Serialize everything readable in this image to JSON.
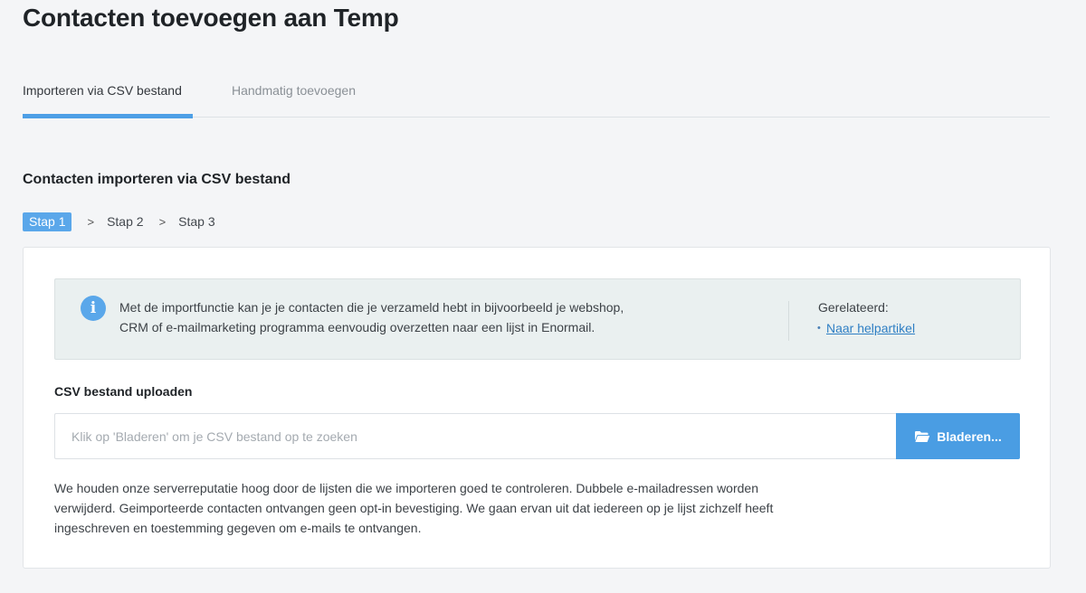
{
  "page": {
    "title": "Contacten toevoegen aan Temp"
  },
  "tabs": [
    {
      "label": "Importeren via CSV bestand",
      "active": true
    },
    {
      "label": "Handmatig toevoegen",
      "active": false
    }
  ],
  "section": {
    "title": "Contacten importeren via CSV bestand"
  },
  "steps": {
    "items": [
      "Stap 1",
      "Stap 2",
      "Stap 3"
    ],
    "separator": ">",
    "active_index": 0
  },
  "info": {
    "icon": "info-icon",
    "icon_glyph": "i",
    "text_line1": "Met de importfunctie kan je je contacten die je verzameld hebt in bijvoorbeeld je webshop,",
    "text_line2": "CRM of e-mailmarketing programma eenvoudig overzetten naar een lijst in Enormail.",
    "related_label": "Gerelateerd:",
    "related_links": [
      "Naar helpartikel"
    ]
  },
  "upload": {
    "label": "CSV bestand uploaden",
    "placeholder": "Klik op 'Bladeren' om je CSV bestand op te zoeken",
    "value": "",
    "browse_label": "Bladeren...",
    "browse_icon": "folder-open-icon"
  },
  "note": {
    "line1": "We houden onze serverreputatie hoog door de lijsten die we importeren goed te controleren. Dubbele e-mailadressen worden",
    "line2": "verwijderd. Geimporteerde contacten ontvangen geen opt-in bevestiging. We gaan ervan uit dat iedereen op je lijst zichzelf heeft",
    "line3": "ingeschreven en toestemming gegeven om e-mails te ontvangen."
  },
  "colors": {
    "accent": "#4a9de3",
    "background": "#f4f5f7",
    "info_background": "#eaf0f0",
    "link": "#2f7fc4"
  }
}
